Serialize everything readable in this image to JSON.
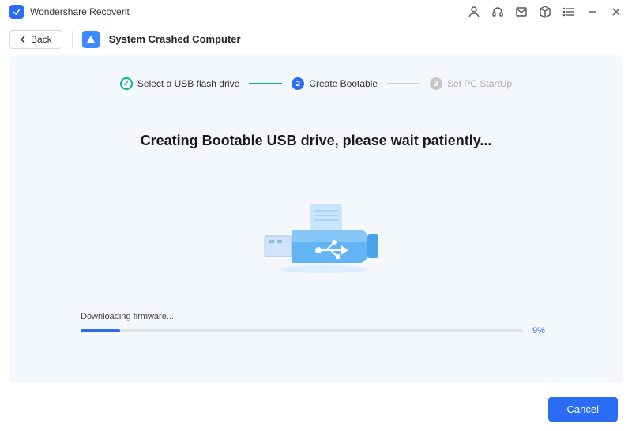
{
  "app": {
    "title": "Wondershare Recoverit"
  },
  "header": {
    "back_label": "Back",
    "module_title": "System Crashed Computer"
  },
  "steps": {
    "s1": {
      "label": "Select a USB flash drive"
    },
    "s2": {
      "num": "2",
      "label": "Create Bootable"
    },
    "s3": {
      "num": "3",
      "label": "Set PC StartUp"
    }
  },
  "main": {
    "heading": "Creating Bootable USB drive, please wait patiently..."
  },
  "progress": {
    "label": "Downloading firmware...",
    "percent_text": "9%",
    "percent_value": 9
  },
  "footer": {
    "cancel_label": "Cancel"
  }
}
